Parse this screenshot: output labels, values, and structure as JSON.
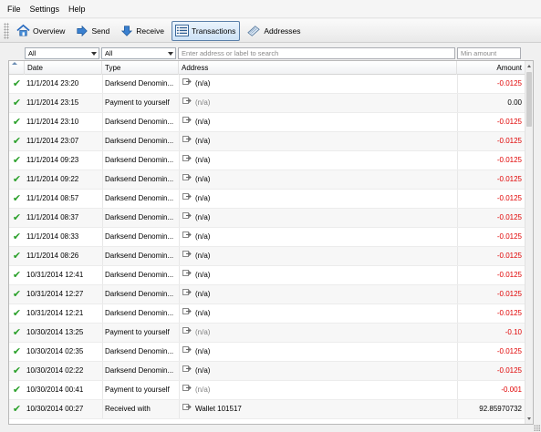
{
  "menu": {
    "items": [
      "File",
      "Settings",
      "Help"
    ]
  },
  "toolbar": {
    "buttons": [
      {
        "label": "Overview",
        "icon": "home-icon"
      },
      {
        "label": "Send",
        "icon": "send-arrow-icon"
      },
      {
        "label": "Receive",
        "icon": "receive-arrow-icon"
      },
      {
        "label": "Transactions",
        "icon": "list-icon",
        "active": true
      },
      {
        "label": "Addresses",
        "icon": "address-book-icon"
      }
    ]
  },
  "filters": {
    "date_filter": "All",
    "type_filter": "All",
    "search_placeholder": "Enter address or label to search",
    "amount_placeholder": "Min amount"
  },
  "table": {
    "columns": {
      "date": "Date",
      "type": "Type",
      "address": "Address",
      "amount": "Amount"
    },
    "rows": [
      {
        "date": "11/1/2014 23:20",
        "type": "Darksend Denomin...",
        "address": "(n/a)",
        "amount": "-0.0125",
        "negative": true,
        "na_grey": false
      },
      {
        "date": "11/1/2014 23:15",
        "type": "Payment to yourself",
        "address": "(n/a)",
        "amount": "0.00",
        "negative": false,
        "na_grey": true
      },
      {
        "date": "11/1/2014 23:10",
        "type": "Darksend Denomin...",
        "address": "(n/a)",
        "amount": "-0.0125",
        "negative": true,
        "na_grey": false
      },
      {
        "date": "11/1/2014 23:07",
        "type": "Darksend Denomin...",
        "address": "(n/a)",
        "amount": "-0.0125",
        "negative": true,
        "na_grey": false
      },
      {
        "date": "11/1/2014 09:23",
        "type": "Darksend Denomin...",
        "address": "(n/a)",
        "amount": "-0.0125",
        "negative": true,
        "na_grey": false
      },
      {
        "date": "11/1/2014 09:22",
        "type": "Darksend Denomin...",
        "address": "(n/a)",
        "amount": "-0.0125",
        "negative": true,
        "na_grey": false
      },
      {
        "date": "11/1/2014 08:57",
        "type": "Darksend Denomin...",
        "address": "(n/a)",
        "amount": "-0.0125",
        "negative": true,
        "na_grey": false
      },
      {
        "date": "11/1/2014 08:37",
        "type": "Darksend Denomin...",
        "address": "(n/a)",
        "amount": "-0.0125",
        "negative": true,
        "na_grey": false
      },
      {
        "date": "11/1/2014 08:33",
        "type": "Darksend Denomin...",
        "address": "(n/a)",
        "amount": "-0.0125",
        "negative": true,
        "na_grey": false
      },
      {
        "date": "11/1/2014 08:26",
        "type": "Darksend Denomin...",
        "address": "(n/a)",
        "amount": "-0.0125",
        "negative": true,
        "na_grey": false
      },
      {
        "date": "10/31/2014 12:41",
        "type": "Darksend Denomin...",
        "address": "(n/a)",
        "amount": "-0.0125",
        "negative": true,
        "na_grey": false
      },
      {
        "date": "10/31/2014 12:27",
        "type": "Darksend Denomin...",
        "address": "(n/a)",
        "amount": "-0.0125",
        "negative": true,
        "na_grey": false
      },
      {
        "date": "10/31/2014 12:21",
        "type": "Darksend Denomin...",
        "address": "(n/a)",
        "amount": "-0.0125",
        "negative": true,
        "na_grey": false
      },
      {
        "date": "10/30/2014 13:25",
        "type": "Payment to yourself",
        "address": "(n/a)",
        "amount": "-0.10",
        "negative": true,
        "na_grey": true
      },
      {
        "date": "10/30/2014 02:35",
        "type": "Darksend Denomin...",
        "address": "(n/a)",
        "amount": "-0.0125",
        "negative": true,
        "na_grey": false
      },
      {
        "date": "10/30/2014 02:22",
        "type": "Darksend Denomin...",
        "address": "(n/a)",
        "amount": "-0.0125",
        "negative": true,
        "na_grey": false
      },
      {
        "date": "10/30/2014 00:41",
        "type": "Payment to yourself",
        "address": "(n/a)",
        "amount": "-0.001",
        "negative": true,
        "na_grey": true
      },
      {
        "date": "10/30/2014 00:27",
        "type": "Received with",
        "address": "Wallet 101517",
        "amount": "92.85970732",
        "negative": false,
        "na_grey": false
      }
    ]
  },
  "colors": {
    "negative": "#e00000",
    "confirmed_check": "#2aa02a",
    "active_tab_border": "#5b7fa8"
  }
}
